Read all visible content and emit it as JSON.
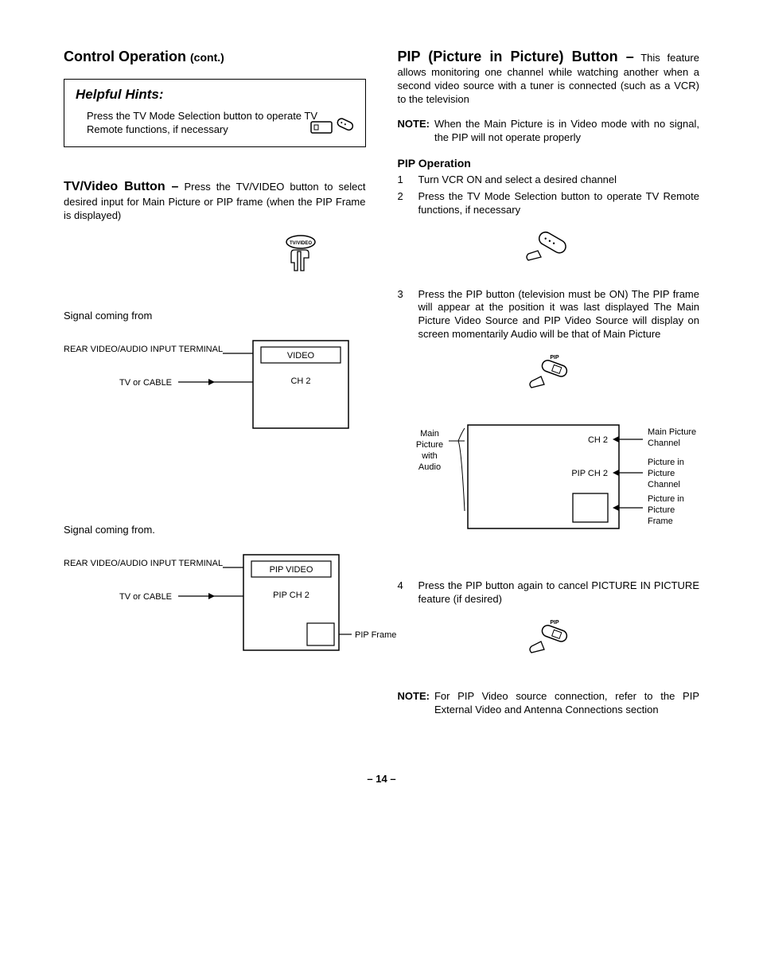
{
  "left": {
    "title_main": "Control Operation",
    "title_cont": "(cont.)",
    "hints": {
      "title": "Helpful Hints:",
      "body": "Press the TV Mode Selection button to operate TV Remote functions, if necessary"
    },
    "tvvideo": {
      "runin": "TV/Video Button –",
      "body": "Press the TV/VIDEO button to select desired input for Main Picture or PIP frame (when the PIP Frame is displayed)"
    },
    "tvvideo_btn_label": "TV/VIDEO",
    "sig1": "Signal coming from",
    "diag1": {
      "rear": "REAR VIDEO/AUDIO INPUT TERMINAL",
      "cable": "TV or CABLE",
      "video": "VIDEO",
      "ch2": "CH 2"
    },
    "sig2": "Signal coming from.",
    "diag2": {
      "rear": "REAR VIDEO/AUDIO INPUT TERMINAL",
      "cable": "TV or CABLE",
      "pipvideo": "PIP VIDEO",
      "pipch2": "PIP CH 2",
      "pipframe": "PIP Frame"
    }
  },
  "right": {
    "pip": {
      "runin": "PIP (Picture in Picture) Button –",
      "body": "This feature allows monitoring one channel while watching another when a second video source with a tuner is connected (such as a VCR) to the television"
    },
    "note1": {
      "label": "NOTE:",
      "body": "When the Main Picture is in Video mode with no signal, the PIP will not operate properly"
    },
    "op_heading": "PIP Operation",
    "steps": {
      "s1": "Turn VCR ON and select a desired channel",
      "s2": "Press the TV Mode Selection button to operate TV Remote functions, if necessary",
      "s3": "Press the PIP button (television must be ON)  The PIP frame will appear at the position it was last displayed  The Main Picture Video Source and PIP Video Source will display on screen momentarily  Audio will be that of Main Picture",
      "s4": "Press the PIP button again to cancel PICTURE IN PICTURE feature (if desired)"
    },
    "pip_btn_label": "PIP",
    "diag3": {
      "main_left": "Main Picture with Audio",
      "ch2": "CH 2",
      "pipch2": "PIP CH 2",
      "r1": "Main Picture Channel",
      "r2": "Picture in Picture Channel",
      "r3": "Picture in Picture Frame"
    },
    "note2": {
      "label": "NOTE:",
      "body": "For PIP Video source connection, refer to the PIP External Video and Antenna Connections section"
    }
  },
  "page_num": "– 14 –"
}
